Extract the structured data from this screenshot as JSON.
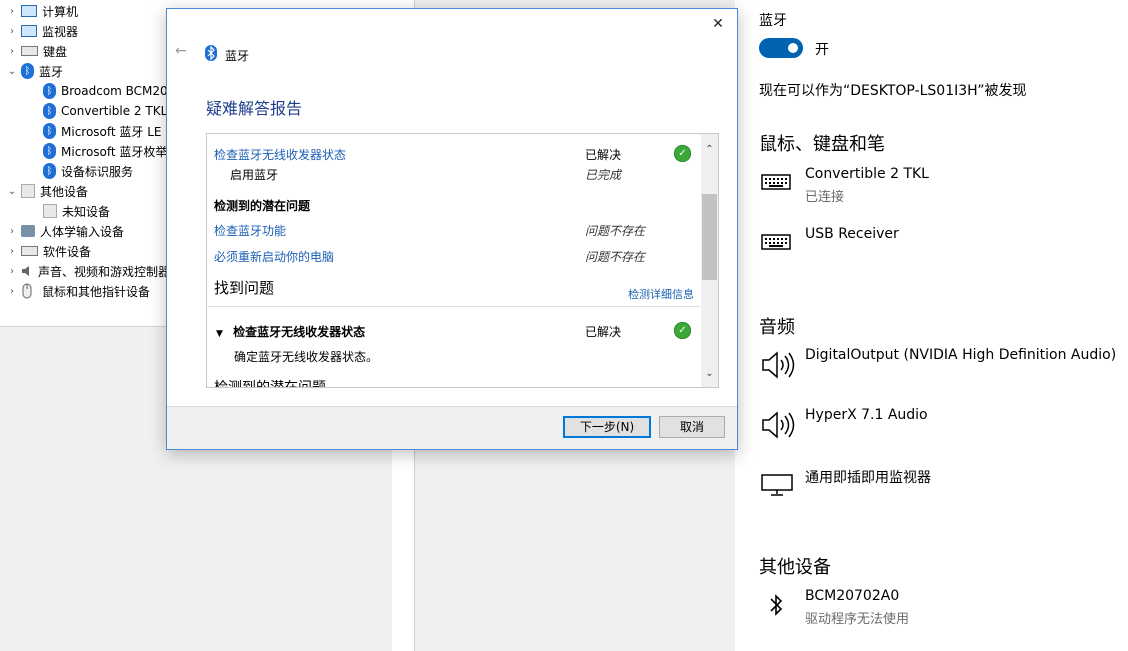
{
  "device_manager": {
    "items": [
      {
        "label": "计算机",
        "expanded": false
      },
      {
        "label": "监视器",
        "expanded": false
      },
      {
        "label": "键盘",
        "expanded": false
      },
      {
        "label": "蓝牙",
        "expanded": true
      },
      {
        "label": "Broadcom BCM20"
      },
      {
        "label": "Convertible 2 TKL"
      },
      {
        "label": "Microsoft 蓝牙 LE"
      },
      {
        "label": "Microsoft 蓝牙枚举"
      },
      {
        "label": "设备标识服务"
      },
      {
        "label": "其他设备",
        "expanded": true
      },
      {
        "label": "未知设备"
      },
      {
        "label": "人体学输入设备",
        "expanded": false
      },
      {
        "label": "软件设备",
        "expanded": false
      },
      {
        "label": "声音、视频和游戏控制器",
        "expanded": false
      },
      {
        "label": "鼠标和其他指针设备",
        "expanded": false
      }
    ]
  },
  "dialog": {
    "title": "蓝牙",
    "close_icon": "close-icon",
    "back_icon": "back-arrow-icon",
    "heading": "疑难解答报告",
    "report": {
      "check1_label": "检查蓝牙无线收发器状态",
      "check1_status": "已解决",
      "check1_sub": "启用蓝牙",
      "check1_sub_status": "已完成",
      "potential_heading": "检测到的潜在问题",
      "issue1_label": "检查蓝牙功能",
      "issue1_status": "问题不存在",
      "issue2_label": "必须重新启动你的电脑",
      "issue2_status": "问题不存在",
      "found_heading": "找到问题",
      "details_link": "检测详细信息",
      "section_label": "检查蓝牙无线收发器状态",
      "section_status": "已解决",
      "section_desc": "确定蓝牙无线收发器状态。",
      "cut_text": "检测到的潜在问题"
    },
    "buttons": {
      "next": "下一步(N)",
      "cancel": "取消"
    }
  },
  "settings": {
    "bluetooth_label": "蓝牙",
    "toggle_label": "开",
    "toggle_on": true,
    "discoverable_text": "现在可以作为“DESKTOP-LS01I3H”被发现",
    "section_input": "鼠标、键盘和笔",
    "devices_input": [
      {
        "name": "Convertible 2 TKL",
        "status": "已连接",
        "icon": "keyboard-icon"
      },
      {
        "name": "USB Receiver",
        "status": "",
        "icon": "keyboard-icon"
      }
    ],
    "section_audio": "音频",
    "devices_audio": [
      {
        "name": "DigitalOutput (NVIDIA High Definition Audio)",
        "icon": "speaker-icon"
      },
      {
        "name": "HyperX 7.1 Audio",
        "icon": "speaker-icon"
      },
      {
        "name": "通用即插即用监视器",
        "icon": "monitor-icon"
      }
    ],
    "section_other": "其他设备",
    "devices_other": [
      {
        "name": "BCM20702A0",
        "status": "驱动程序无法使用",
        "icon": "bluetooth-icon"
      }
    ]
  },
  "colors": {
    "accent": "#0063b1",
    "link": "#1a5fb4",
    "heading": "#1e3e8c",
    "success": "#3aa93a"
  }
}
